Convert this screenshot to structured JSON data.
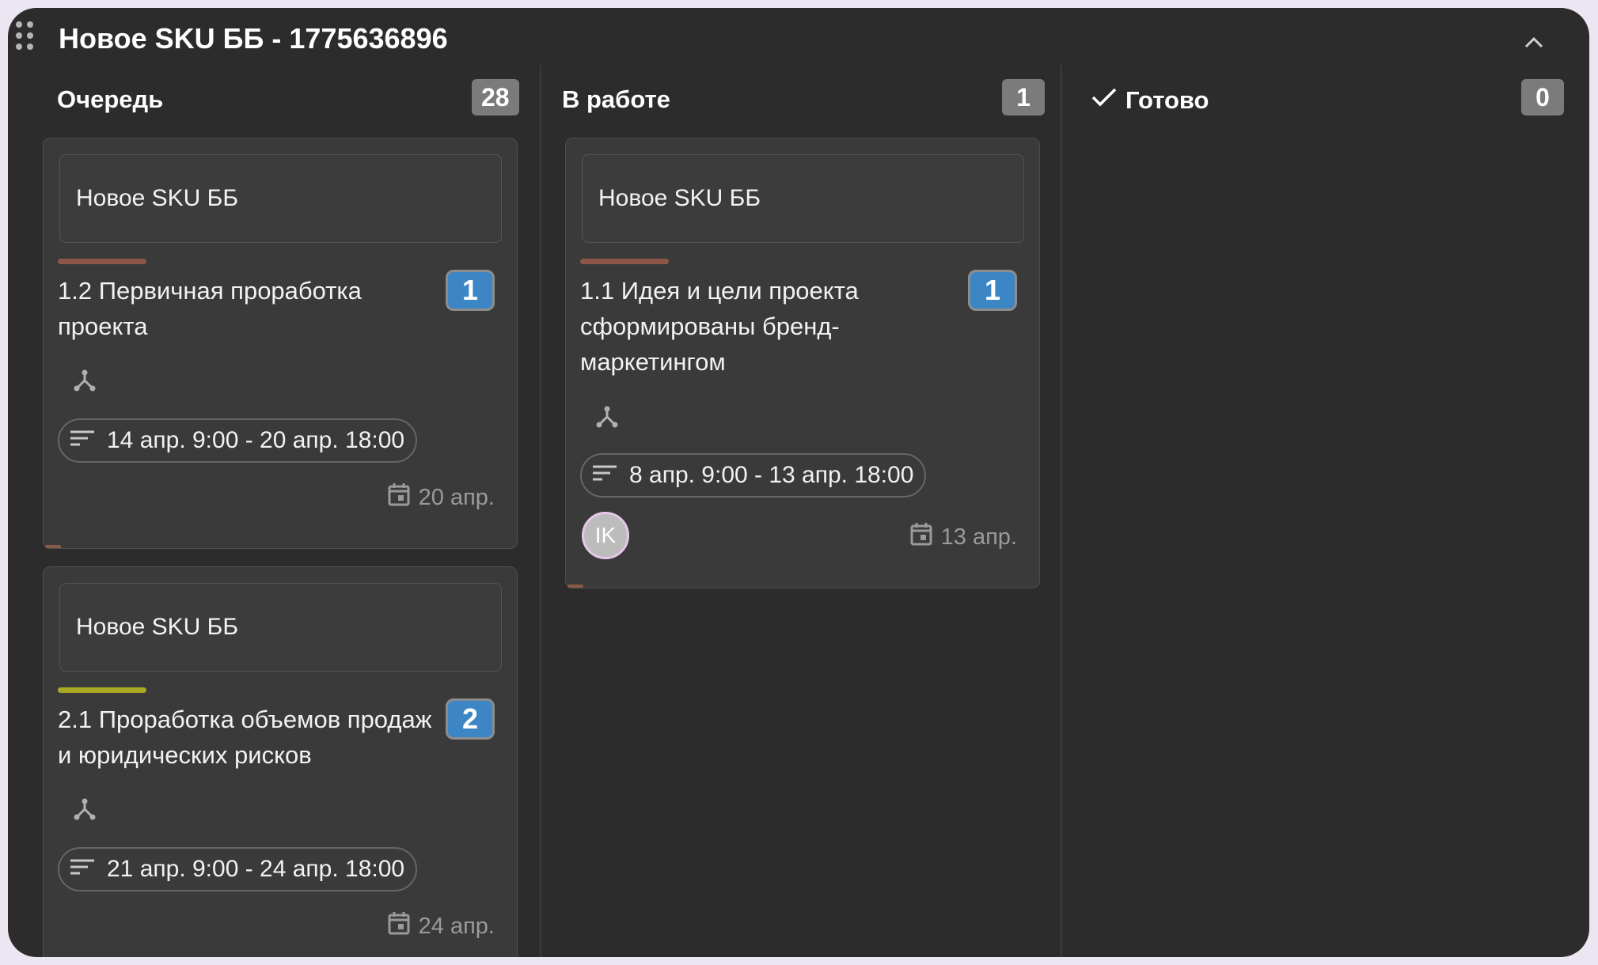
{
  "board": {
    "title": "Новое SKU ББ - 1775636896"
  },
  "columns": [
    {
      "title": "Очередь",
      "count": "28"
    },
    {
      "title": "В работе",
      "count": "1"
    },
    {
      "title": "Готово",
      "count": "0"
    }
  ],
  "cards": [
    {
      "project": "Новое SKU ББ",
      "stripe_color": "#8c5648",
      "title": "1.2 Первичная проработка проекта",
      "number": "1",
      "period": "14 апр. 9:00 - 20 апр. 18:00",
      "due": "20 апр."
    },
    {
      "project": "Новое SKU ББ",
      "stripe_color": "#a8a824",
      "title": "2.1 Проработка объемов продаж и юридических рисков",
      "number": "2",
      "period": "21 апр. 9:00 - 24 апр. 18:00",
      "due": "24 апр."
    },
    {
      "project": "Новое SKU ББ",
      "stripe_color": "#8c5648",
      "title": "1.1 Идея и цели проекта сформированы бренд-маркетингом",
      "number": "1",
      "period": "8 апр. 9:00 - 13 апр. 18:00",
      "due": "13 апр.",
      "assignee_initials": "IK"
    }
  ],
  "icons": {
    "drag": "drag-handle-icon",
    "collapse": "chevron-up-icon",
    "done": "check-icon",
    "dependency": "dependency-icon",
    "period": "period-lines-icon",
    "due": "calendar-icon"
  },
  "colors": {
    "background": "#2c2c2c",
    "card": "#3a3a3a",
    "count_badge": "#7b7b7b",
    "number_badge": "#3d86c6"
  }
}
